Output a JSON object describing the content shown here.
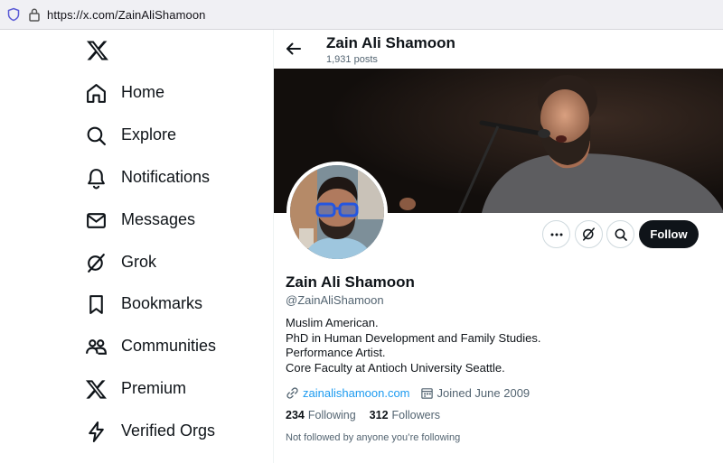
{
  "browser": {
    "url": "https://x.com/ZainAliShamoon",
    "icons": {
      "shield": "shield-icon",
      "lock": "lock-icon"
    }
  },
  "sidebar": {
    "logo": "x-logo-icon",
    "items": [
      {
        "label": "Home",
        "icon": "home-icon"
      },
      {
        "label": "Explore",
        "icon": "search-icon"
      },
      {
        "label": "Notifications",
        "icon": "bell-icon"
      },
      {
        "label": "Messages",
        "icon": "envelope-icon"
      },
      {
        "label": "Grok",
        "icon": "grok-icon"
      },
      {
        "label": "Bookmarks",
        "icon": "bookmark-icon"
      },
      {
        "label": "Communities",
        "icon": "people-icon"
      },
      {
        "label": "Premium",
        "icon": "x-logo-icon"
      },
      {
        "label": "Verified Orgs",
        "icon": "lightning-icon"
      }
    ]
  },
  "header": {
    "name": "Zain Ali Shamoon",
    "posts": "1,931 posts"
  },
  "actions": {
    "follow_label": "Follow"
  },
  "profile": {
    "name": "Zain Ali Shamoon",
    "handle": "@ZainAliShamoon",
    "bio": [
      "Muslim American.",
      "PhD in Human Development and Family Studies.",
      "Performance Artist.",
      "Core Faculty at Antioch University Seattle."
    ],
    "website": "zainalishamoon.com",
    "joined": "Joined June 2009",
    "following_count": "234",
    "following_label": "Following",
    "followers_count": "312",
    "followers_label": "Followers",
    "not_followed_text": "Not followed by anyone you’re following"
  },
  "colors": {
    "text": "#0f1419",
    "secondary": "#536471",
    "link": "#1d9bf0",
    "follow_bg": "#0f1419"
  }
}
